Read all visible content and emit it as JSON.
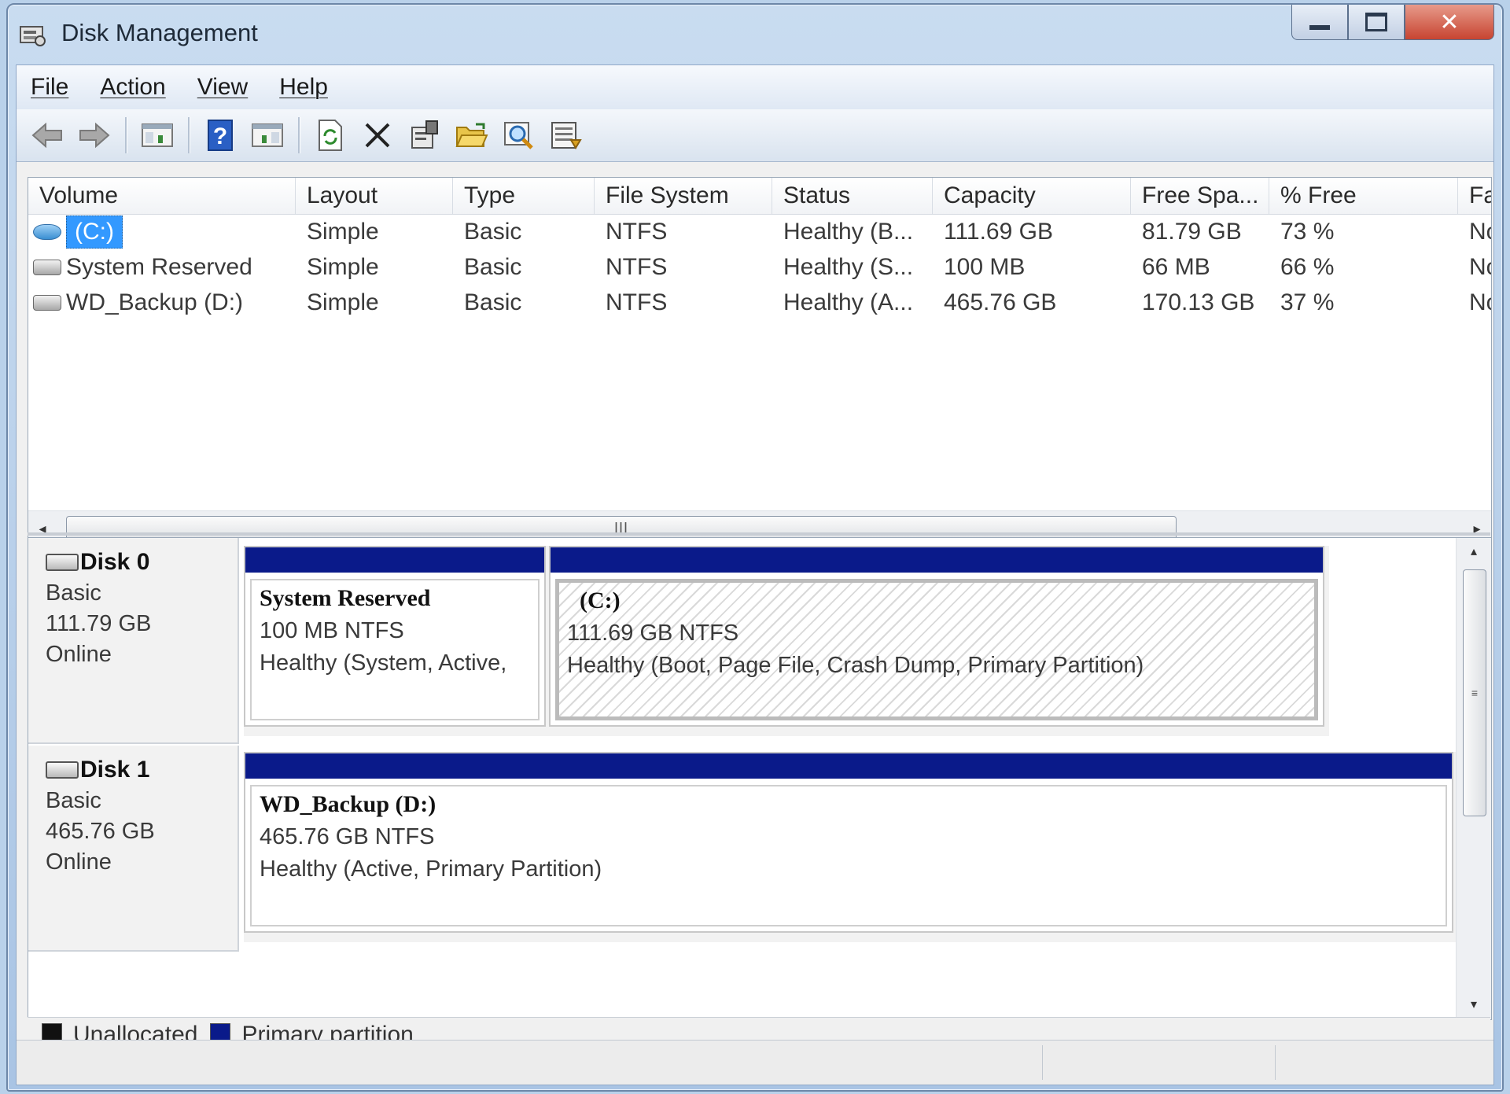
{
  "window": {
    "title": "Disk Management"
  },
  "menu": {
    "items": [
      "File",
      "Action",
      "View",
      "Help"
    ]
  },
  "toolbar": {
    "buttons": [
      "back-arrow-icon",
      "forward-arrow-icon",
      "console-tree-icon",
      "help-icon",
      "show-pane-icon",
      "refresh-icon",
      "delete-icon",
      "properties-icon",
      "open-folder-icon",
      "search-icon",
      "export-list-icon"
    ]
  },
  "volume_list": {
    "columns": [
      "Volume",
      "Layout",
      "Type",
      "File System",
      "Status",
      "Capacity",
      "Free Spa...",
      "% Free",
      "Fa"
    ],
    "rows": [
      {
        "volume": "(C:)",
        "layout": "Simple",
        "type": "Basic",
        "fs": "NTFS",
        "status": "Healthy (B...",
        "capacity": "111.69 GB",
        "free": "81.79 GB",
        "pct": "73 %",
        "fa": "No",
        "icon": "blue-volume-icon"
      },
      {
        "volume": "System Reserved",
        "layout": "Simple",
        "type": "Basic",
        "fs": "NTFS",
        "status": "Healthy (S...",
        "capacity": "100 MB",
        "free": "66 MB",
        "pct": "66 %",
        "fa": "No",
        "icon": "gray-volume-icon"
      },
      {
        "volume": "WD_Backup (D:)",
        "layout": "Simple",
        "type": "Basic",
        "fs": "NTFS",
        "status": "Healthy (A...",
        "capacity": "465.76 GB",
        "free": "170.13 GB",
        "pct": "37 %",
        "fa": "No",
        "icon": "gray-volume-icon"
      }
    ],
    "scroll_grip": "III"
  },
  "disks": [
    {
      "name": "Disk 0",
      "kind": "Basic",
      "size": "111.79 GB",
      "state": "Online",
      "partitions": [
        {
          "name": "System Reserved",
          "size_fs": "100 MB NTFS",
          "status": "Healthy (System, Active,"
        },
        {
          "name": "(C:)",
          "size_fs": "111.69 GB NTFS",
          "status": "Healthy (Boot, Page File, Crash Dump, Primary Partition)"
        }
      ]
    },
    {
      "name": "Disk 1",
      "kind": "Basic",
      "size": "465.76 GB",
      "state": "Online",
      "partitions": [
        {
          "name": "WD_Backup  (D:)",
          "size_fs": "465.76 GB NTFS",
          "status": "Healthy (Active, Primary Partition)"
        }
      ]
    }
  ],
  "legend": {
    "items": [
      {
        "label": "Unallocated",
        "color": "#111111"
      },
      {
        "label": "Primary partition",
        "color": "#0a1a8a"
      }
    ]
  },
  "colors": {
    "primary_partition": "#0a1a8a",
    "selection": "#3399ff",
    "close_button": "#c74431"
  }
}
